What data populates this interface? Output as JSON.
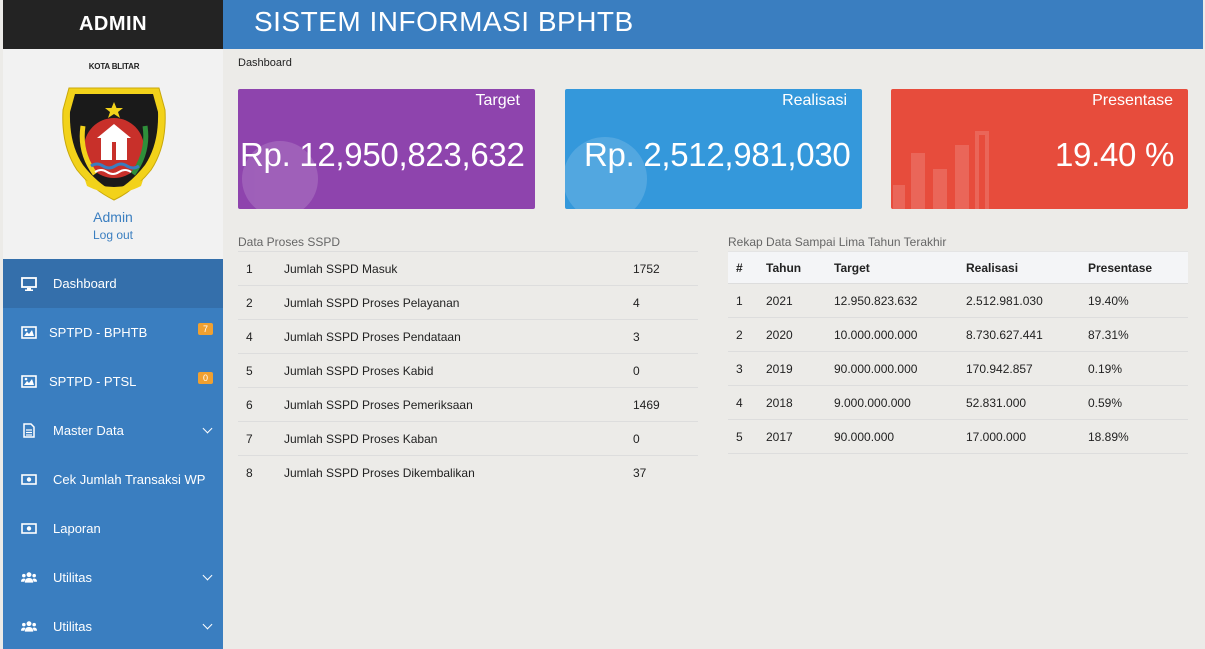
{
  "sidebar": {
    "brand": "ADMIN",
    "crest_label": "KOTA BLITAR",
    "user_name": "Admin",
    "logout_label": "Log out",
    "items": [
      {
        "label": "Dashboard",
        "icon": "monitor-icon"
      },
      {
        "label": "SPTPD - BPHTB",
        "icon": "image-icon",
        "badge": "7"
      },
      {
        "label": "SPTPD - PTSL",
        "icon": "image-icon",
        "badge": "0"
      },
      {
        "label": "Master Data",
        "icon": "document-icon"
      },
      {
        "label": "Cek Jumlah Transaksi WP",
        "icon": "money-icon"
      },
      {
        "label": "Laporan",
        "icon": "money-icon"
      },
      {
        "label": "Utilitas",
        "icon": "users-icon"
      },
      {
        "label": "Utilitas",
        "icon": "users-icon"
      }
    ]
  },
  "header": {
    "title": "SISTEM INFORMASI BPHTB"
  },
  "breadcrumb": "Dashboard",
  "cards": {
    "target": {
      "label": "Target",
      "value": "Rp. 12,950,823,632",
      "color": "#8e44ad"
    },
    "realisasi": {
      "label": "Realisasi",
      "value": "Rp. 2,512,981,030",
      "color": "#3498db"
    },
    "presentase": {
      "label": "Presentase",
      "value": "19.40 %",
      "color": "#e74c3c"
    }
  },
  "sspd": {
    "title": "Data Proses SSPD",
    "rows": [
      {
        "no": "1",
        "label": "Jumlah SSPD Masuk",
        "value": "1752"
      },
      {
        "no": "2",
        "label": "Jumlah SSPD Proses Pelayanan",
        "value": "4"
      },
      {
        "no": "4",
        "label": "Jumlah SSPD Proses Pendataan",
        "value": "3"
      },
      {
        "no": "5",
        "label": "Jumlah SSPD Proses Kabid",
        "value": "0"
      },
      {
        "no": "6",
        "label": "Jumlah SSPD Proses Pemeriksaan",
        "value": "1469"
      },
      {
        "no": "7",
        "label": "Jumlah SSPD Proses Kaban",
        "value": "0"
      },
      {
        "no": "8",
        "label": "Jumlah SSPD Proses Dikembalikan",
        "value": "37"
      }
    ]
  },
  "rekap": {
    "title": "Rekap Data Sampai Lima Tahun Terakhir",
    "headers": [
      "#",
      "Tahun",
      "Target",
      "Realisasi",
      "Presentase"
    ],
    "rows": [
      [
        "1",
        "2021",
        "12.950.823.632",
        "2.512.981.030",
        "19.40%"
      ],
      [
        "2",
        "2020",
        "10.000.000.000",
        "8.730.627.441",
        "87.31%"
      ],
      [
        "3",
        "2019",
        "90.000.000.000",
        "170.942.857",
        "0.19%"
      ],
      [
        "4",
        "2018",
        "9.000.000.000",
        "52.831.000",
        "0.59%"
      ],
      [
        "5",
        "2017",
        "90.000.000",
        "17.000.000",
        "18.89%"
      ]
    ]
  }
}
